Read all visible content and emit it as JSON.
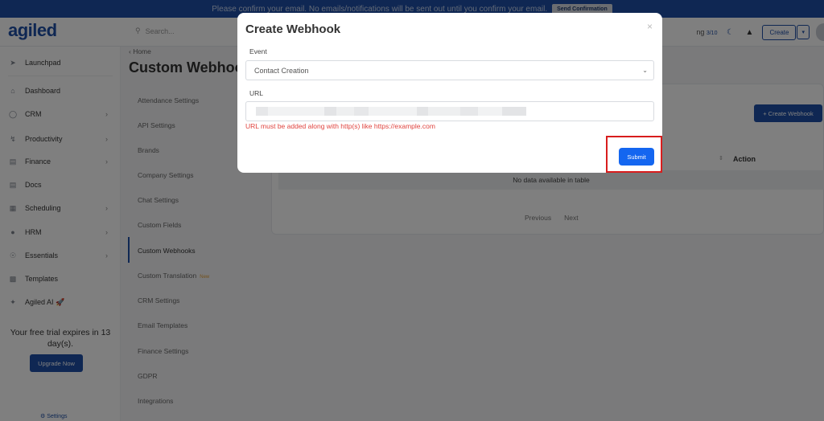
{
  "banner": {
    "message": "Please confirm your email. No emails/notifications will be sent out until you confirm your email.",
    "button_label": "Send Confirmation"
  },
  "header": {
    "logo": "agiled",
    "search_placeholder": "Search...",
    "progress_label": "ng",
    "progress_count": "3/10",
    "create_label": "Create"
  },
  "sidebar": {
    "items": [
      {
        "label": "Launchpad",
        "icon": "rocket-icon",
        "has_chevron": false
      },
      {
        "label": "Dashboard",
        "icon": "home-icon",
        "has_chevron": false
      },
      {
        "label": "CRM",
        "icon": "user-icon",
        "has_chevron": true
      },
      {
        "label": "Productivity",
        "icon": "flow-icon",
        "has_chevron": true
      },
      {
        "label": "Finance",
        "icon": "file-icon",
        "has_chevron": true
      },
      {
        "label": "Docs",
        "icon": "docs-icon",
        "has_chevron": false
      },
      {
        "label": "Scheduling",
        "icon": "calendar-icon",
        "has_chevron": true
      },
      {
        "label": "HRM",
        "icon": "team-icon",
        "has_chevron": true
      },
      {
        "label": "Essentials",
        "icon": "bulb-icon",
        "has_chevron": true
      },
      {
        "label": "Templates",
        "icon": "template-icon",
        "has_chevron": false
      },
      {
        "label": "Agiled AI 🚀",
        "icon": "wand-icon",
        "has_chevron": false
      }
    ],
    "trial_text": "Your free trial expires in 13 day(s).",
    "upgrade_label": "Upgrade Now",
    "settings_label": "Settings"
  },
  "breadcrumb": "‹ Home",
  "page_title": "Custom Webhooks",
  "settings_menu": [
    {
      "label": "Attendance Settings"
    },
    {
      "label": "API Settings"
    },
    {
      "label": "Brands"
    },
    {
      "label": "Company Settings"
    },
    {
      "label": "Chat Settings"
    },
    {
      "label": "Custom Fields"
    },
    {
      "label": "Custom Webhooks",
      "active": true
    },
    {
      "label": "Custom Translation",
      "badge": "New"
    },
    {
      "label": "CRM Settings"
    },
    {
      "label": "Email Templates"
    },
    {
      "label": "Finance Settings"
    },
    {
      "label": "GDPR"
    },
    {
      "label": "Integrations"
    }
  ],
  "content": {
    "add_button": "+ Create Webhook",
    "column_action": "Action",
    "no_data": "No data available in table",
    "prev": "Previous",
    "next": "Next"
  },
  "modal": {
    "title": "Create Webhook",
    "close": "×",
    "event_label": "Event",
    "event_value": "Contact Creation",
    "url_label": "URL",
    "url_error": "URL must be added along with http(s) like https://example.com",
    "submit_label": "Submit"
  },
  "colors": {
    "brand": "#1e4fa6",
    "submit": "#1466f0",
    "error": "#e0443f",
    "highlight": "#d81d1d"
  }
}
